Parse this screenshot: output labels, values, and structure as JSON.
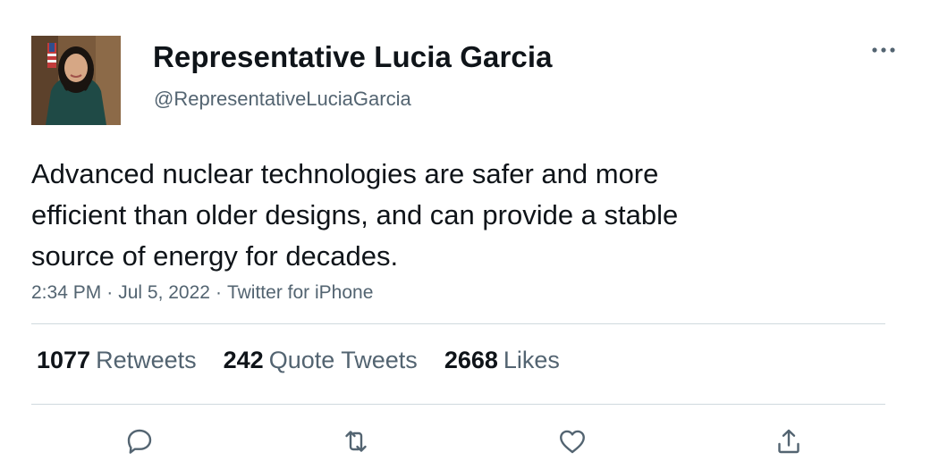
{
  "author": {
    "display_name": "Representative Lucia Garcia",
    "handle": "@RepresentativeLuciaGarcia",
    "avatar_icon": "profile-photo"
  },
  "tweet": {
    "text_lines": [
      "Advanced nuclear technologies are safer and more",
      "efficient than older designs, and can provide a stable",
      "source of energy for decades."
    ],
    "time": "2:34 PM",
    "date": "Jul 5, 2022",
    "source": "Twitter for iPhone",
    "separator": "·"
  },
  "stats": {
    "retweets": {
      "count": "1077",
      "label": "Retweets"
    },
    "quotes": {
      "count": "242",
      "label": "Quote Tweets"
    },
    "likes": {
      "count": "2668",
      "label": "Likes"
    }
  },
  "actions": [
    {
      "icon": "reply-icon"
    },
    {
      "icon": "retweet-icon"
    },
    {
      "icon": "like-icon"
    },
    {
      "icon": "share-icon"
    }
  ],
  "colors": {
    "text_primary": "#0f1419",
    "text_secondary": "#536471",
    "divider": "#cfd9de"
  }
}
